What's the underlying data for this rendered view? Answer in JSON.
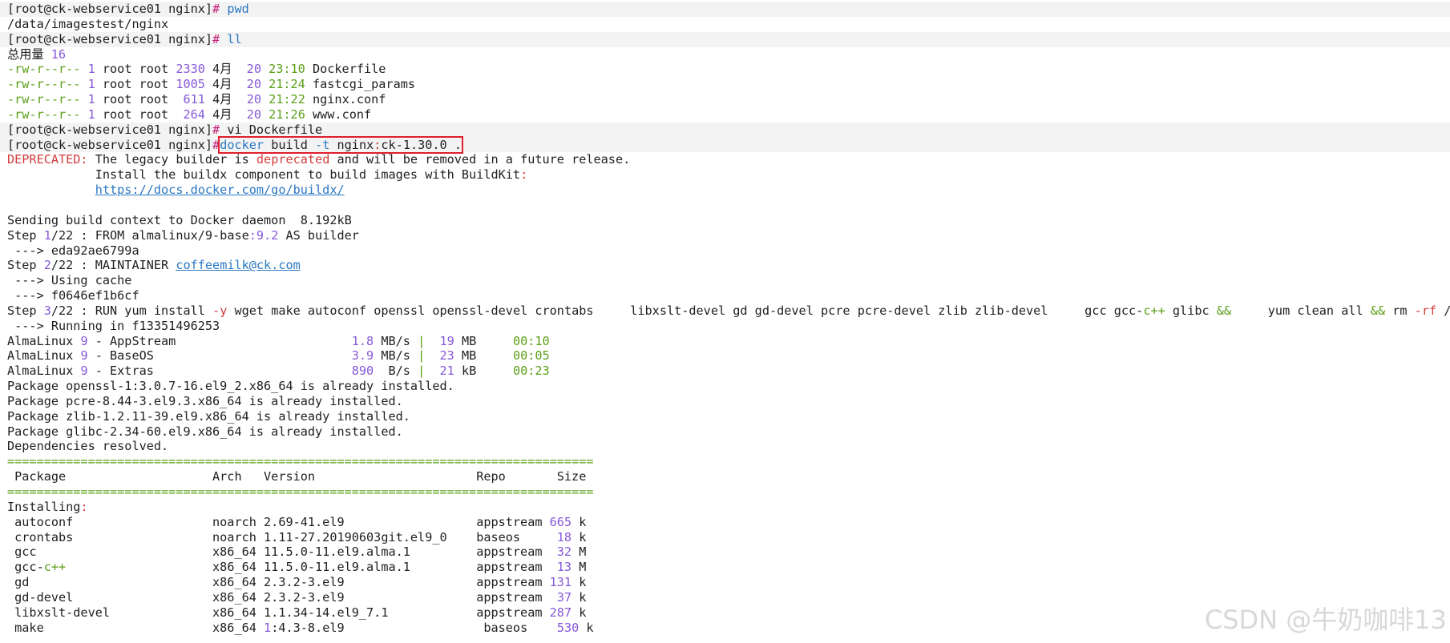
{
  "colors": {
    "prompt_hash": "#c51b73",
    "cmd": "#2a78c2",
    "green": "#5a9f17",
    "purple": "#8659d8",
    "red": "#d33c3c",
    "highlight_box": "#e01e2d"
  },
  "watermark": "CSDN @牛奶咖啡13",
  "lines": [
    [
      {
        "t": "[root@ck-webservice01 nginx]",
        "c": "c-prompt"
      },
      {
        "t": "# ",
        "c": "c-hash"
      },
      {
        "t": "pwd",
        "c": "c-cmd"
      }
    ],
    [
      {
        "t": "/data/imagestest/nginx",
        "c": ""
      }
    ],
    [
      {
        "t": "[root@ck-webservice01 nginx]",
        "c": "c-prompt"
      },
      {
        "t": "# ",
        "c": "c-hash"
      },
      {
        "t": "ll",
        "c": "c-cmd"
      }
    ],
    [
      {
        "t": "总用量 ",
        "c": ""
      },
      {
        "t": "16",
        "c": "c-purple"
      }
    ],
    [
      {
        "t": "-rw-r--r-- ",
        "c": "c-green"
      },
      {
        "t": "1 ",
        "c": "c-purple"
      },
      {
        "t": "root root ",
        "c": ""
      },
      {
        "t": "2330 ",
        "c": "c-purple"
      },
      {
        "t": "4月  ",
        "c": ""
      },
      {
        "t": "20 ",
        "c": "c-purple"
      },
      {
        "t": "23:10 ",
        "c": "c-green"
      },
      {
        "t": "Dockerfile",
        "c": ""
      }
    ],
    [
      {
        "t": "-rw-r--r-- ",
        "c": "c-green"
      },
      {
        "t": "1 ",
        "c": "c-purple"
      },
      {
        "t": "root root ",
        "c": ""
      },
      {
        "t": "1005 ",
        "c": "c-purple"
      },
      {
        "t": "4月  ",
        "c": ""
      },
      {
        "t": "20 ",
        "c": "c-purple"
      },
      {
        "t": "21:24 ",
        "c": "c-green"
      },
      {
        "t": "fastcgi_params",
        "c": ""
      }
    ],
    [
      {
        "t": "-rw-r--r-- ",
        "c": "c-green"
      },
      {
        "t": "1 ",
        "c": "c-purple"
      },
      {
        "t": "root root  ",
        "c": ""
      },
      {
        "t": "611 ",
        "c": "c-purple"
      },
      {
        "t": "4月  ",
        "c": ""
      },
      {
        "t": "20 ",
        "c": "c-purple"
      },
      {
        "t": "21:22 ",
        "c": "c-green"
      },
      {
        "t": "nginx.conf",
        "c": ""
      }
    ],
    [
      {
        "t": "-rw-r--r-- ",
        "c": "c-green"
      },
      {
        "t": "1 ",
        "c": "c-purple"
      },
      {
        "t": "root root  ",
        "c": ""
      },
      {
        "t": "264 ",
        "c": "c-purple"
      },
      {
        "t": "4月  ",
        "c": ""
      },
      {
        "t": "20 ",
        "c": "c-purple"
      },
      {
        "t": "21:26 ",
        "c": "c-green"
      },
      {
        "t": "www.conf",
        "c": ""
      }
    ],
    [
      {
        "t": "[root@ck-webservice01 nginx]",
        "c": "c-prompt"
      },
      {
        "t": "# ",
        "c": "c-hash"
      },
      {
        "t": "vi Dockerfile",
        "c": ""
      }
    ],
    [
      {
        "t": "[root@ck-webservice01 nginx]",
        "c": "c-prompt"
      },
      {
        "t": "#",
        "c": "c-hash"
      },
      {
        "t": "docker ",
        "c": "c-cmd",
        "hl": true
      },
      {
        "t": "build ",
        "c": "",
        "hl": true
      },
      {
        "t": "-t ",
        "c": "c-cmd",
        "hl": true
      },
      {
        "t": "nginx",
        "c": "",
        "hl": true
      },
      {
        "t": ":",
        "c": "c-red",
        "hl": true
      },
      {
        "t": "ck-1.30.0 .",
        "c": "",
        "hl": true
      }
    ],
    [
      {
        "t": "DEPRECATED:",
        "c": "c-red"
      },
      {
        "t": " The legacy builder is ",
        "c": ""
      },
      {
        "t": "deprecated",
        "c": "c-red"
      },
      {
        "t": " and will be removed in a future release.",
        "c": ""
      }
    ],
    [
      {
        "t": "            Install the buildx component to build images with BuildKit",
        "c": ""
      },
      {
        "t": ":",
        "c": "c-red"
      }
    ],
    [
      {
        "t": "            ",
        "c": ""
      },
      {
        "t": "https://docs.docker.com/go/buildx/",
        "c": "c-link"
      }
    ],
    [
      {
        "t": "",
        "c": ""
      }
    ],
    [
      {
        "t": "Sending build context to Docker daemon  8.192kB",
        "c": ""
      }
    ],
    [
      {
        "t": "Step ",
        "c": ""
      },
      {
        "t": "1",
        "c": "c-purple"
      },
      {
        "t": "/22 : FROM almalinux/9-base",
        "c": ""
      },
      {
        "t": ":9.2",
        "c": "c-purple"
      },
      {
        "t": " AS builder",
        "c": ""
      }
    ],
    [
      {
        "t": " ---> eda92ae6799a",
        "c": ""
      }
    ],
    [
      {
        "t": "Step ",
        "c": ""
      },
      {
        "t": "2",
        "c": "c-purple"
      },
      {
        "t": "/22 : MAINTAINER ",
        "c": ""
      },
      {
        "t": "coffeemilk@ck.com",
        "c": "c-link"
      }
    ],
    [
      {
        "t": " ---> Using cache",
        "c": ""
      }
    ],
    [
      {
        "t": " ---> f0646ef1b6cf",
        "c": ""
      }
    ],
    [
      {
        "t": "Step ",
        "c": ""
      },
      {
        "t": "3",
        "c": "c-purple"
      },
      {
        "t": "/22 : RUN yum install ",
        "c": ""
      },
      {
        "t": "-y",
        "c": "c-red"
      },
      {
        "t": " wget make autoconf openssl openssl-devel crontabs     libxslt-devel gd gd-devel pcre pcre-devel zlib zlib-devel     gcc gcc-",
        "c": ""
      },
      {
        "t": "c++",
        "c": "c-green"
      },
      {
        "t": " glibc ",
        "c": ""
      },
      {
        "t": "&&",
        "c": "c-green"
      },
      {
        "t": "     yum clean all ",
        "c": ""
      },
      {
        "t": "&&",
        "c": "c-green"
      },
      {
        "t": " rm ",
        "c": ""
      },
      {
        "t": "-rf",
        "c": "c-red"
      },
      {
        "t": " /var/cache",
        "c": ""
      }
    ],
    [
      {
        "t": " ---> Running in f13351496253",
        "c": ""
      }
    ],
    [
      {
        "t": "AlmaLinux ",
        "c": ""
      },
      {
        "t": "9",
        "c": "c-purple"
      },
      {
        "t": " - AppStream                        ",
        "c": ""
      },
      {
        "t": "1.8",
        "c": "c-purple"
      },
      {
        "t": " MB/s ",
        "c": ""
      },
      {
        "t": "|",
        "c": "c-green"
      },
      {
        "t": "  ",
        "c": ""
      },
      {
        "t": "19",
        "c": "c-purple"
      },
      {
        "t": " MB     ",
        "c": ""
      },
      {
        "t": "00:10",
        "c": "c-green"
      }
    ],
    [
      {
        "t": "AlmaLinux ",
        "c": ""
      },
      {
        "t": "9",
        "c": "c-purple"
      },
      {
        "t": " - BaseOS                           ",
        "c": ""
      },
      {
        "t": "3.9",
        "c": "c-purple"
      },
      {
        "t": " MB/s ",
        "c": ""
      },
      {
        "t": "|",
        "c": "c-green"
      },
      {
        "t": "  ",
        "c": ""
      },
      {
        "t": "23",
        "c": "c-purple"
      },
      {
        "t": " MB     ",
        "c": ""
      },
      {
        "t": "00:05",
        "c": "c-green"
      }
    ],
    [
      {
        "t": "AlmaLinux ",
        "c": ""
      },
      {
        "t": "9",
        "c": "c-purple"
      },
      {
        "t": " - Extras                           ",
        "c": ""
      },
      {
        "t": "890",
        "c": "c-purple"
      },
      {
        "t": "  B/s ",
        "c": ""
      },
      {
        "t": "|",
        "c": "c-green"
      },
      {
        "t": "  ",
        "c": ""
      },
      {
        "t": "21",
        "c": "c-purple"
      },
      {
        "t": " kB     ",
        "c": ""
      },
      {
        "t": "00:23",
        "c": "c-green"
      }
    ],
    [
      {
        "t": "Package openssl-1:3.0.7-16.el9_2.x86_64 is already installed.",
        "c": ""
      }
    ],
    [
      {
        "t": "Package pcre-8.44-3.el9.3.x86_64 is already installed.",
        "c": ""
      }
    ],
    [
      {
        "t": "Package zlib-1.2.11-39.el9.x86_64 is already installed.",
        "c": ""
      }
    ],
    [
      {
        "t": "Package glibc-2.34-60.el9.x86_64 is already installed.",
        "c": ""
      }
    ],
    [
      {
        "t": "Dependencies resolved.",
        "c": ""
      }
    ],
    [
      {
        "t": "================================================================================",
        "c": "c-rule"
      }
    ],
    [
      {
        "t": " Package                    Arch   Version                      Repo       Size",
        "c": ""
      }
    ],
    [
      {
        "t": "================================================================================",
        "c": "c-rule"
      }
    ],
    [
      {
        "t": "Installing",
        "c": ""
      },
      {
        "t": ":",
        "c": "c-red"
      }
    ],
    [
      {
        "t": " autoconf                   noarch 2.69-41.el9                  appstream ",
        "c": ""
      },
      {
        "t": "665",
        "c": "c-purple"
      },
      {
        "t": " k",
        "c": ""
      }
    ],
    [
      {
        "t": " crontabs                   noarch 1.11-27.20190603git.el9_0    baseos     ",
        "c": ""
      },
      {
        "t": "18",
        "c": "c-purple"
      },
      {
        "t": " k",
        "c": ""
      }
    ],
    [
      {
        "t": " gcc                        x86_64 11.5.0-11.el9.alma.1         appstream  ",
        "c": ""
      },
      {
        "t": "32",
        "c": "c-purple"
      },
      {
        "t": " M",
        "c": ""
      }
    ],
    [
      {
        "t": " gcc-",
        "c": ""
      },
      {
        "t": "c++",
        "c": "c-green"
      },
      {
        "t": "                    x86_64 11.5.0-11.el9.alma.1         appstream  ",
        "c": ""
      },
      {
        "t": "13",
        "c": "c-purple"
      },
      {
        "t": " M",
        "c": ""
      }
    ],
    [
      {
        "t": " gd                         x86_64 2.3.2-3.el9                  appstream ",
        "c": ""
      },
      {
        "t": "131",
        "c": "c-purple"
      },
      {
        "t": " k",
        "c": ""
      }
    ],
    [
      {
        "t": " gd-devel                   x86_64 2.3.2-3.el9                  appstream  ",
        "c": ""
      },
      {
        "t": "37",
        "c": "c-purple"
      },
      {
        "t": " k",
        "c": ""
      }
    ],
    [
      {
        "t": " libxslt-devel              x86_64 1.1.34-14.el9_7.1            appstream ",
        "c": ""
      },
      {
        "t": "287",
        "c": "c-purple"
      },
      {
        "t": " k",
        "c": ""
      }
    ],
    [
      {
        "t": " make                       x86_64 ",
        "c": ""
      },
      {
        "t": "1",
        "c": "c-purple"
      },
      {
        "t": ":4.3-8.el9                   baseos    ",
        "c": ""
      },
      {
        "t": "530",
        "c": "c-purple"
      },
      {
        "t": " k",
        "c": ""
      }
    ]
  ]
}
